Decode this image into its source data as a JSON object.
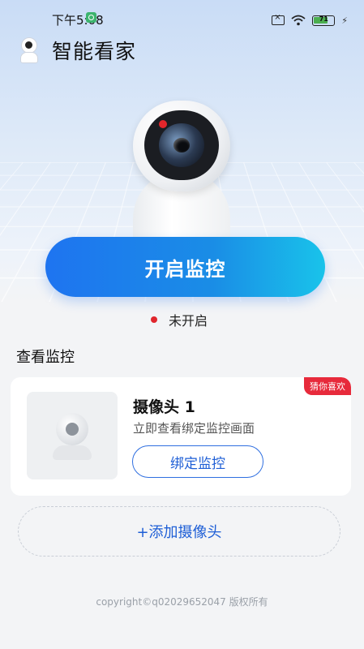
{
  "status_bar": {
    "time": "下午5:08",
    "battery_level": "71",
    "icons": [
      "sim-off-icon",
      "wifi-icon",
      "battery-icon",
      "charging-icon"
    ]
  },
  "header": {
    "title": "智能看家",
    "logo_icon": "camera-logo-icon"
  },
  "hero": {
    "start_button": "开启监控",
    "status_text": "未开启",
    "status_color": "#e0262d"
  },
  "section": {
    "title": "查看监控"
  },
  "card": {
    "tag": "猜你喜欢",
    "title": "摄像头 1",
    "description": "立即查看绑定监控画面",
    "bind_button": "绑定监控"
  },
  "add_camera": {
    "label": "+添加摄像头"
  },
  "footer": {
    "copyright": "copyright©q02029652047 版权所有"
  },
  "colors": {
    "accent": "#1e74f0",
    "tag": "#e72a3b"
  }
}
